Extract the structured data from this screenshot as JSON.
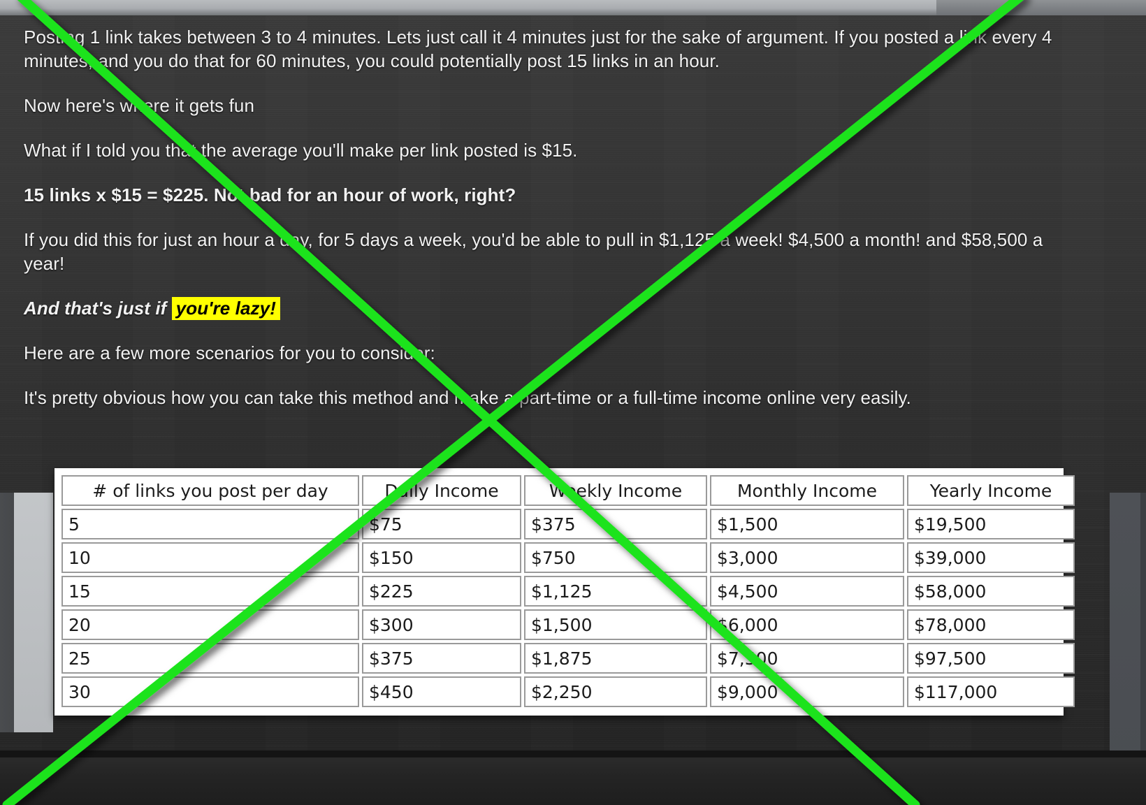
{
  "article": {
    "paragraphs": [
      {
        "id": "p1",
        "style": "normal",
        "text": "Posting 1 link takes between 3 to 4 minutes. Lets just call it 4 minutes just for the sake of argument. If you posted a link every 4 minutes, and you do that for 60 minutes, you could potentially post 15 links in an hour."
      },
      {
        "id": "p2",
        "style": "normal",
        "text": "Now here's where it gets fun"
      },
      {
        "id": "p3",
        "style": "normal",
        "text": "What if I told you that the average you'll make per link posted is $15."
      },
      {
        "id": "p4",
        "style": "bold",
        "text": "15 links x $15 = $225. Not bad for an hour of work, right?"
      },
      {
        "id": "p5",
        "style": "normal",
        "text": "If you did this for just an hour a day, for 5 days a week, you'd be able to pull in $1,125 a week! $4,500 a month! and $58,500 a year!"
      },
      {
        "id": "p6",
        "style": "italic-highlight",
        "lead": "And that's just if ",
        "highlight": "you're lazy!"
      },
      {
        "id": "p7",
        "style": "normal",
        "text": "Here are a few more scenarios for you to consider:"
      },
      {
        "id": "p8",
        "style": "normal",
        "text": "It's pretty obvious how you can take this method and make a part-time or a full-time income online very easily."
      }
    ]
  },
  "table": {
    "headers": [
      "# of links you post per day",
      "Daily Income",
      "Weekly Income",
      "Monthly Income",
      "Yearly Income"
    ],
    "rows": [
      [
        "5",
        "$75",
        "$375",
        "$1,500",
        "$19,500"
      ],
      [
        "10",
        "$150",
        "$750",
        "$3,000",
        "$39,000"
      ],
      [
        "15",
        "$225",
        "$1,125",
        "$4,500",
        "$58,000"
      ],
      [
        "20",
        "$300",
        "$1,500",
        "$6,000",
        "$78,000"
      ],
      [
        "25",
        "$375",
        "$1,875",
        "$7,500",
        "$97,500"
      ],
      [
        "30",
        "$450",
        "$2,250",
        "$9,000",
        "$117,000"
      ]
    ]
  },
  "overlay": {
    "annotation_name": "green-x-cross-out",
    "color": "#1ee31e",
    "stroke_width": 13
  }
}
